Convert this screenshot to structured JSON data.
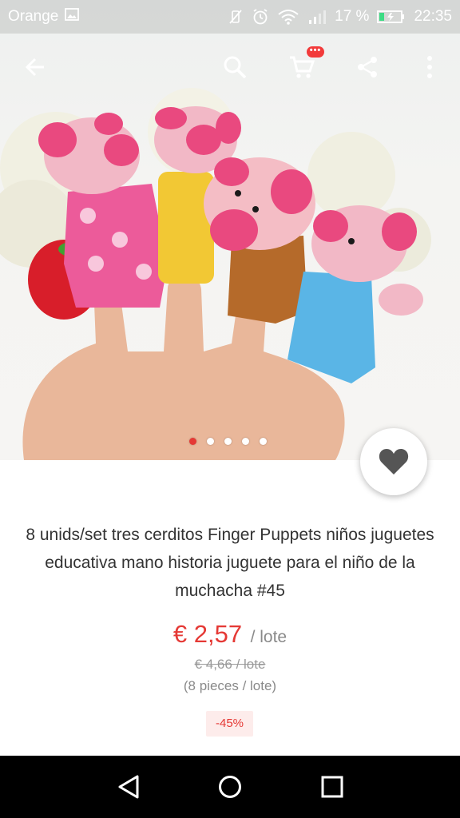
{
  "status_bar": {
    "carrier": "Orange",
    "battery": "17 %",
    "time": "22:35",
    "icons": [
      "image-icon",
      "no-vibrate-icon",
      "alarm-icon",
      "wifi-icon",
      "signal-icon",
      "battery-icon"
    ]
  },
  "toolbar": {
    "icons": [
      "back-arrow-icon",
      "search-icon",
      "cart-icon",
      "share-icon",
      "more-vert-icon"
    ],
    "cart_badge": "•••"
  },
  "carousel": {
    "count": 5,
    "active_index": 0
  },
  "product": {
    "title": "8 unids/set tres cerditos Finger Puppets niños juguetes educativa mano historia juguete para el niño de la muchacha #45",
    "price": "€ 2,57",
    "unit": "/ lote",
    "original_price": "€ 4,66 / lote",
    "pieces": "(8 pieces / lote)",
    "discount": "-45%"
  },
  "colors": {
    "accent": "#e53935",
    "text": "#333333",
    "muted": "#8a8a8a"
  },
  "nav_bar": {
    "icons": [
      "back-triangle-icon",
      "home-circle-icon",
      "recents-square-icon"
    ]
  }
}
